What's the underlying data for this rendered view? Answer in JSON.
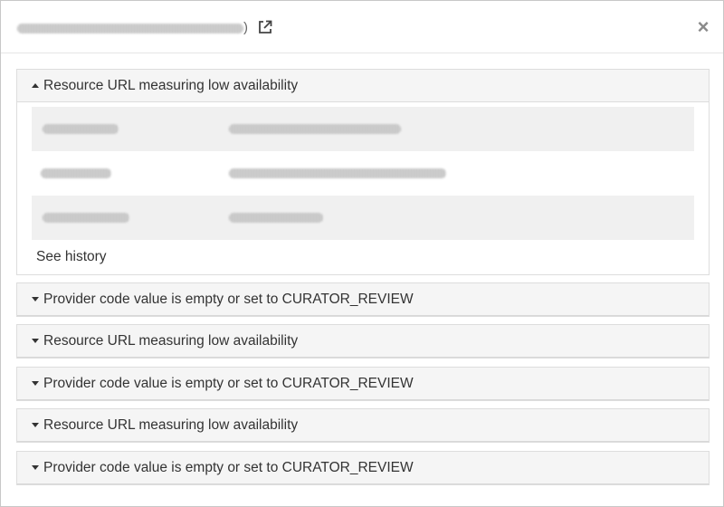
{
  "header": {
    "title_tail": ")",
    "icons": {
      "external": "external-link-icon",
      "close": "close-icon"
    },
    "close_glyph": "×"
  },
  "panels": [
    {
      "label": "Resource URL measuring low availability",
      "expanded": true,
      "see_history": "See history"
    },
    {
      "label": "Provider code value is empty or set to CURATOR_REVIEW",
      "expanded": false
    },
    {
      "label": "Resource URL measuring low availability",
      "expanded": false
    },
    {
      "label": "Provider code value is empty or set to CURATOR_REVIEW",
      "expanded": false
    },
    {
      "label": "Resource URL measuring low availability",
      "expanded": false
    },
    {
      "label": "Provider code value is empty or set to CURATOR_REVIEW",
      "expanded": false
    }
  ],
  "colors": {
    "panel_heading_bg": "#f5f5f5",
    "border": "#dddddd",
    "row_shade": "#f0f0f0",
    "text": "#333333"
  }
}
